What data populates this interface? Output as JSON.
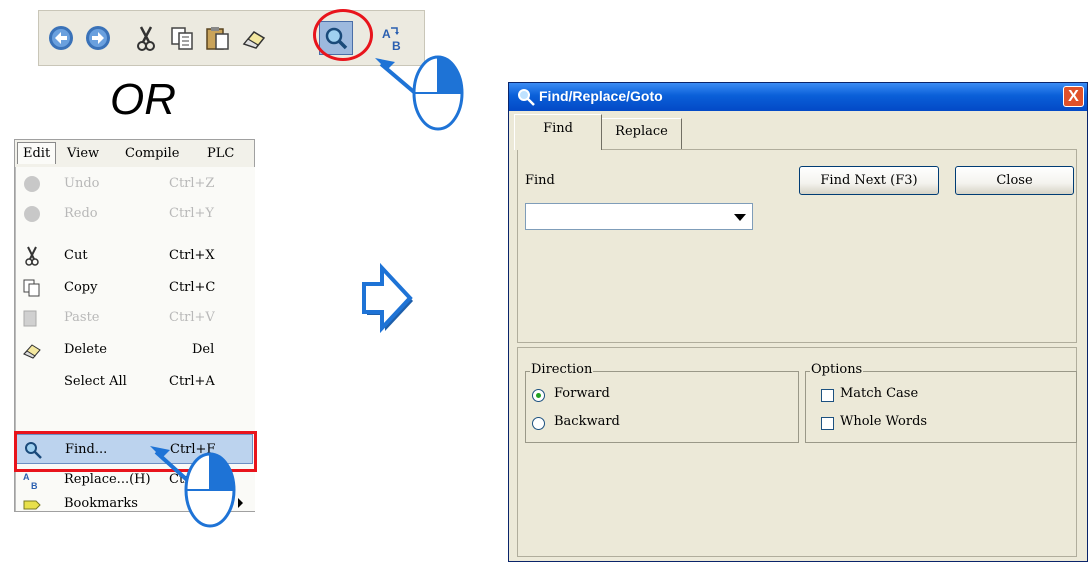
{
  "toolbar": {
    "buttons": [
      "undo-icon",
      "redo-icon",
      "cut-icon",
      "copy-icon",
      "paste-icon",
      "delete-icon",
      "find-icon",
      "replace-icon"
    ]
  },
  "separator_text": "OR",
  "menu": {
    "menubar": [
      "Edit",
      "View",
      "Compile",
      "PLC"
    ],
    "items": [
      {
        "label": "Undo",
        "shortcut": "Ctrl+Z",
        "icon": "undo-icon"
      },
      {
        "label": "Redo",
        "shortcut": "Ctrl+Y",
        "icon": "redo-icon"
      },
      {
        "label": "Cut",
        "shortcut": "Ctrl+X",
        "icon": "cut-icon"
      },
      {
        "label": "Copy",
        "shortcut": "Ctrl+C",
        "icon": "copy-icon"
      },
      {
        "label": "Paste",
        "shortcut": "Ctrl+V",
        "icon": "paste-icon"
      },
      {
        "label": "Delete",
        "shortcut": "Del",
        "icon": "delete-icon"
      },
      {
        "label": "Select All",
        "shortcut": "Ctrl+A",
        "icon": ""
      },
      {
        "label": "Find...",
        "shortcut": "Ctrl+F",
        "icon": "find-icon"
      },
      {
        "label": "Replace...(H)",
        "shortcut": "Ctrl+",
        "icon": "replace-icon"
      },
      {
        "label": "Bookmarks",
        "shortcut": "",
        "icon": "bookmark-icon"
      }
    ]
  },
  "dialog": {
    "title": "Find/Replace/Goto",
    "close_label": "X",
    "tabs": [
      "Find",
      "Replace"
    ],
    "find_label": "Find",
    "find_value": "",
    "find_next_button": "Find Next (F3)",
    "close_button": "Close",
    "direction": {
      "title": "Direction",
      "options": [
        "Forward",
        "Backward"
      ],
      "selected": "Forward"
    },
    "options": {
      "title": "Options",
      "items": [
        "Match Case",
        "Whole Words"
      ]
    }
  },
  "colors": {
    "highlight_red": "#e8141c",
    "arrow_blue": "#1e73d6",
    "title_blue": "#0a5fd8"
  }
}
